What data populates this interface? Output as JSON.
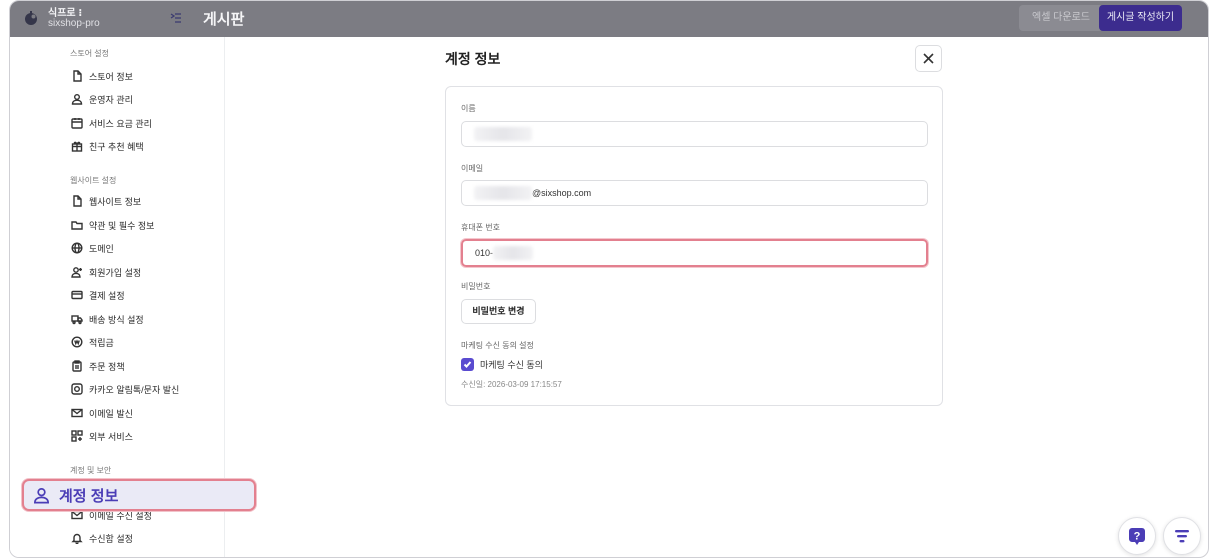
{
  "header": {
    "shop_name": "식프로 ⁝",
    "shop_sub": "sixshop-pro",
    "page_title": "게시판",
    "excel_download_label": "엑셀 다운로드",
    "write_post_label": "게시글 작성하기"
  },
  "sidebar": {
    "store_section": {
      "title": "스토어 설정",
      "items": [
        {
          "label": "스토어 정보",
          "icon": "document-icon"
        },
        {
          "label": "운영자 관리",
          "icon": "user-icon"
        },
        {
          "label": "서비스 요금 관리",
          "icon": "calendar-icon"
        },
        {
          "label": "친구 추천 혜택",
          "icon": "gift-icon"
        }
      ]
    },
    "website_section": {
      "title": "웹사이트 설정",
      "items": [
        {
          "label": "웹사이트 정보",
          "icon": "document-icon"
        },
        {
          "label": "약관 및 필수 정보",
          "icon": "folder-icon"
        },
        {
          "label": "도메인",
          "icon": "globe-icon"
        },
        {
          "label": "회원가입 설정",
          "icon": "user-add-icon"
        },
        {
          "label": "결제 설정",
          "icon": "card-icon"
        },
        {
          "label": "배송 방식 설정",
          "icon": "truck-icon"
        },
        {
          "label": "적립금",
          "icon": "coin-icon"
        },
        {
          "label": "주문 정책",
          "icon": "clipboard-icon"
        },
        {
          "label": "카카오 알림톡/문자 발신",
          "icon": "chat-icon"
        },
        {
          "label": "이메일 발신",
          "icon": "mail-icon"
        },
        {
          "label": "외부 서비스",
          "icon": "apps-icon"
        }
      ]
    },
    "account_section": {
      "title": "계정 및 보안",
      "active_item": "계정 정보",
      "items": [
        {
          "label": "이메일 수신 설정",
          "icon": "mail-icon"
        },
        {
          "label": "수신함 설정",
          "icon": "bell-icon"
        }
      ]
    }
  },
  "panel": {
    "title": "계정 정보",
    "name_label": "이름",
    "email_label": "이메일",
    "email_domain": "@sixshop.com",
    "phone_label": "휴대폰 번호",
    "phone_prefix": "010-",
    "password_label": "비밀번호",
    "password_button": "비밀번호 변경",
    "marketing_label": "마케팅 수신 동의 설정",
    "marketing_checkbox_label": "마케팅 수신 동의",
    "marketing_checked": true,
    "consent_date": "수신일:  2026-03-09 17:15:57"
  },
  "colors": {
    "accent": "#4b3db6",
    "highlight_border": "#e3808f",
    "topbar": "#7c7c83"
  }
}
